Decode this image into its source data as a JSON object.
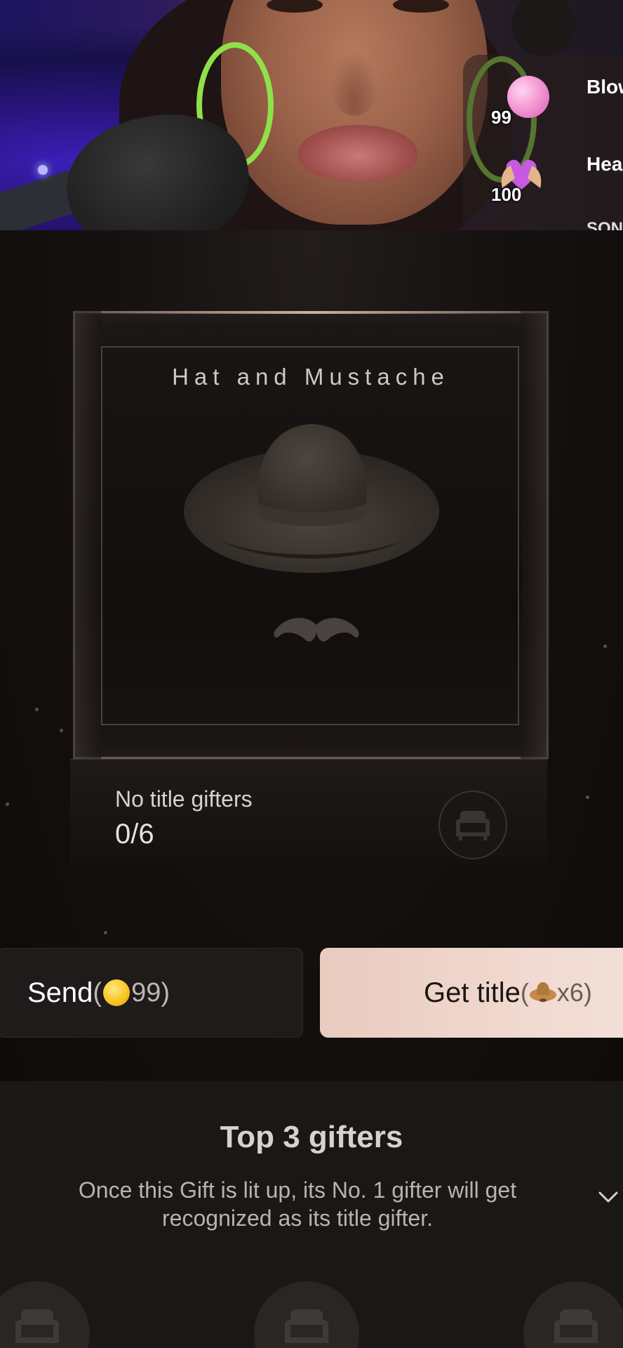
{
  "stream": {
    "gift_feed": [
      {
        "icon": "bubble-gift-icon",
        "coins": "99",
        "name": "Blow the bubble"
      },
      {
        "icon": "heart-hands-gift-icon",
        "coins": "100",
        "name": "Heart g"
      },
      {
        "icon": "song-gift-icon",
        "coins": "",
        "name": "SONG"
      }
    ]
  },
  "gift_panel": {
    "gift_name": "Hat and Mustache",
    "title_status": {
      "label": "No title gifters",
      "progress": "0/6",
      "progress_value": 0,
      "progress_total": 6
    },
    "send_button": {
      "label": "Send",
      "open_paren": "(",
      "price": "99",
      "close_paren": ")"
    },
    "get_title_button": {
      "label": "Get title",
      "open_paren": "(",
      "multiplier": "x6",
      "close_paren": ")"
    }
  },
  "top_gifters": {
    "heading": "Top 3 gifters",
    "description": "Once this Gift is lit up, its No. 1 gifter will get recognized as its title gifter."
  },
  "colors": {
    "get_title_bg": "#efd6cc",
    "coin": "#f7c21c",
    "panel_bg": "#120f0e"
  }
}
